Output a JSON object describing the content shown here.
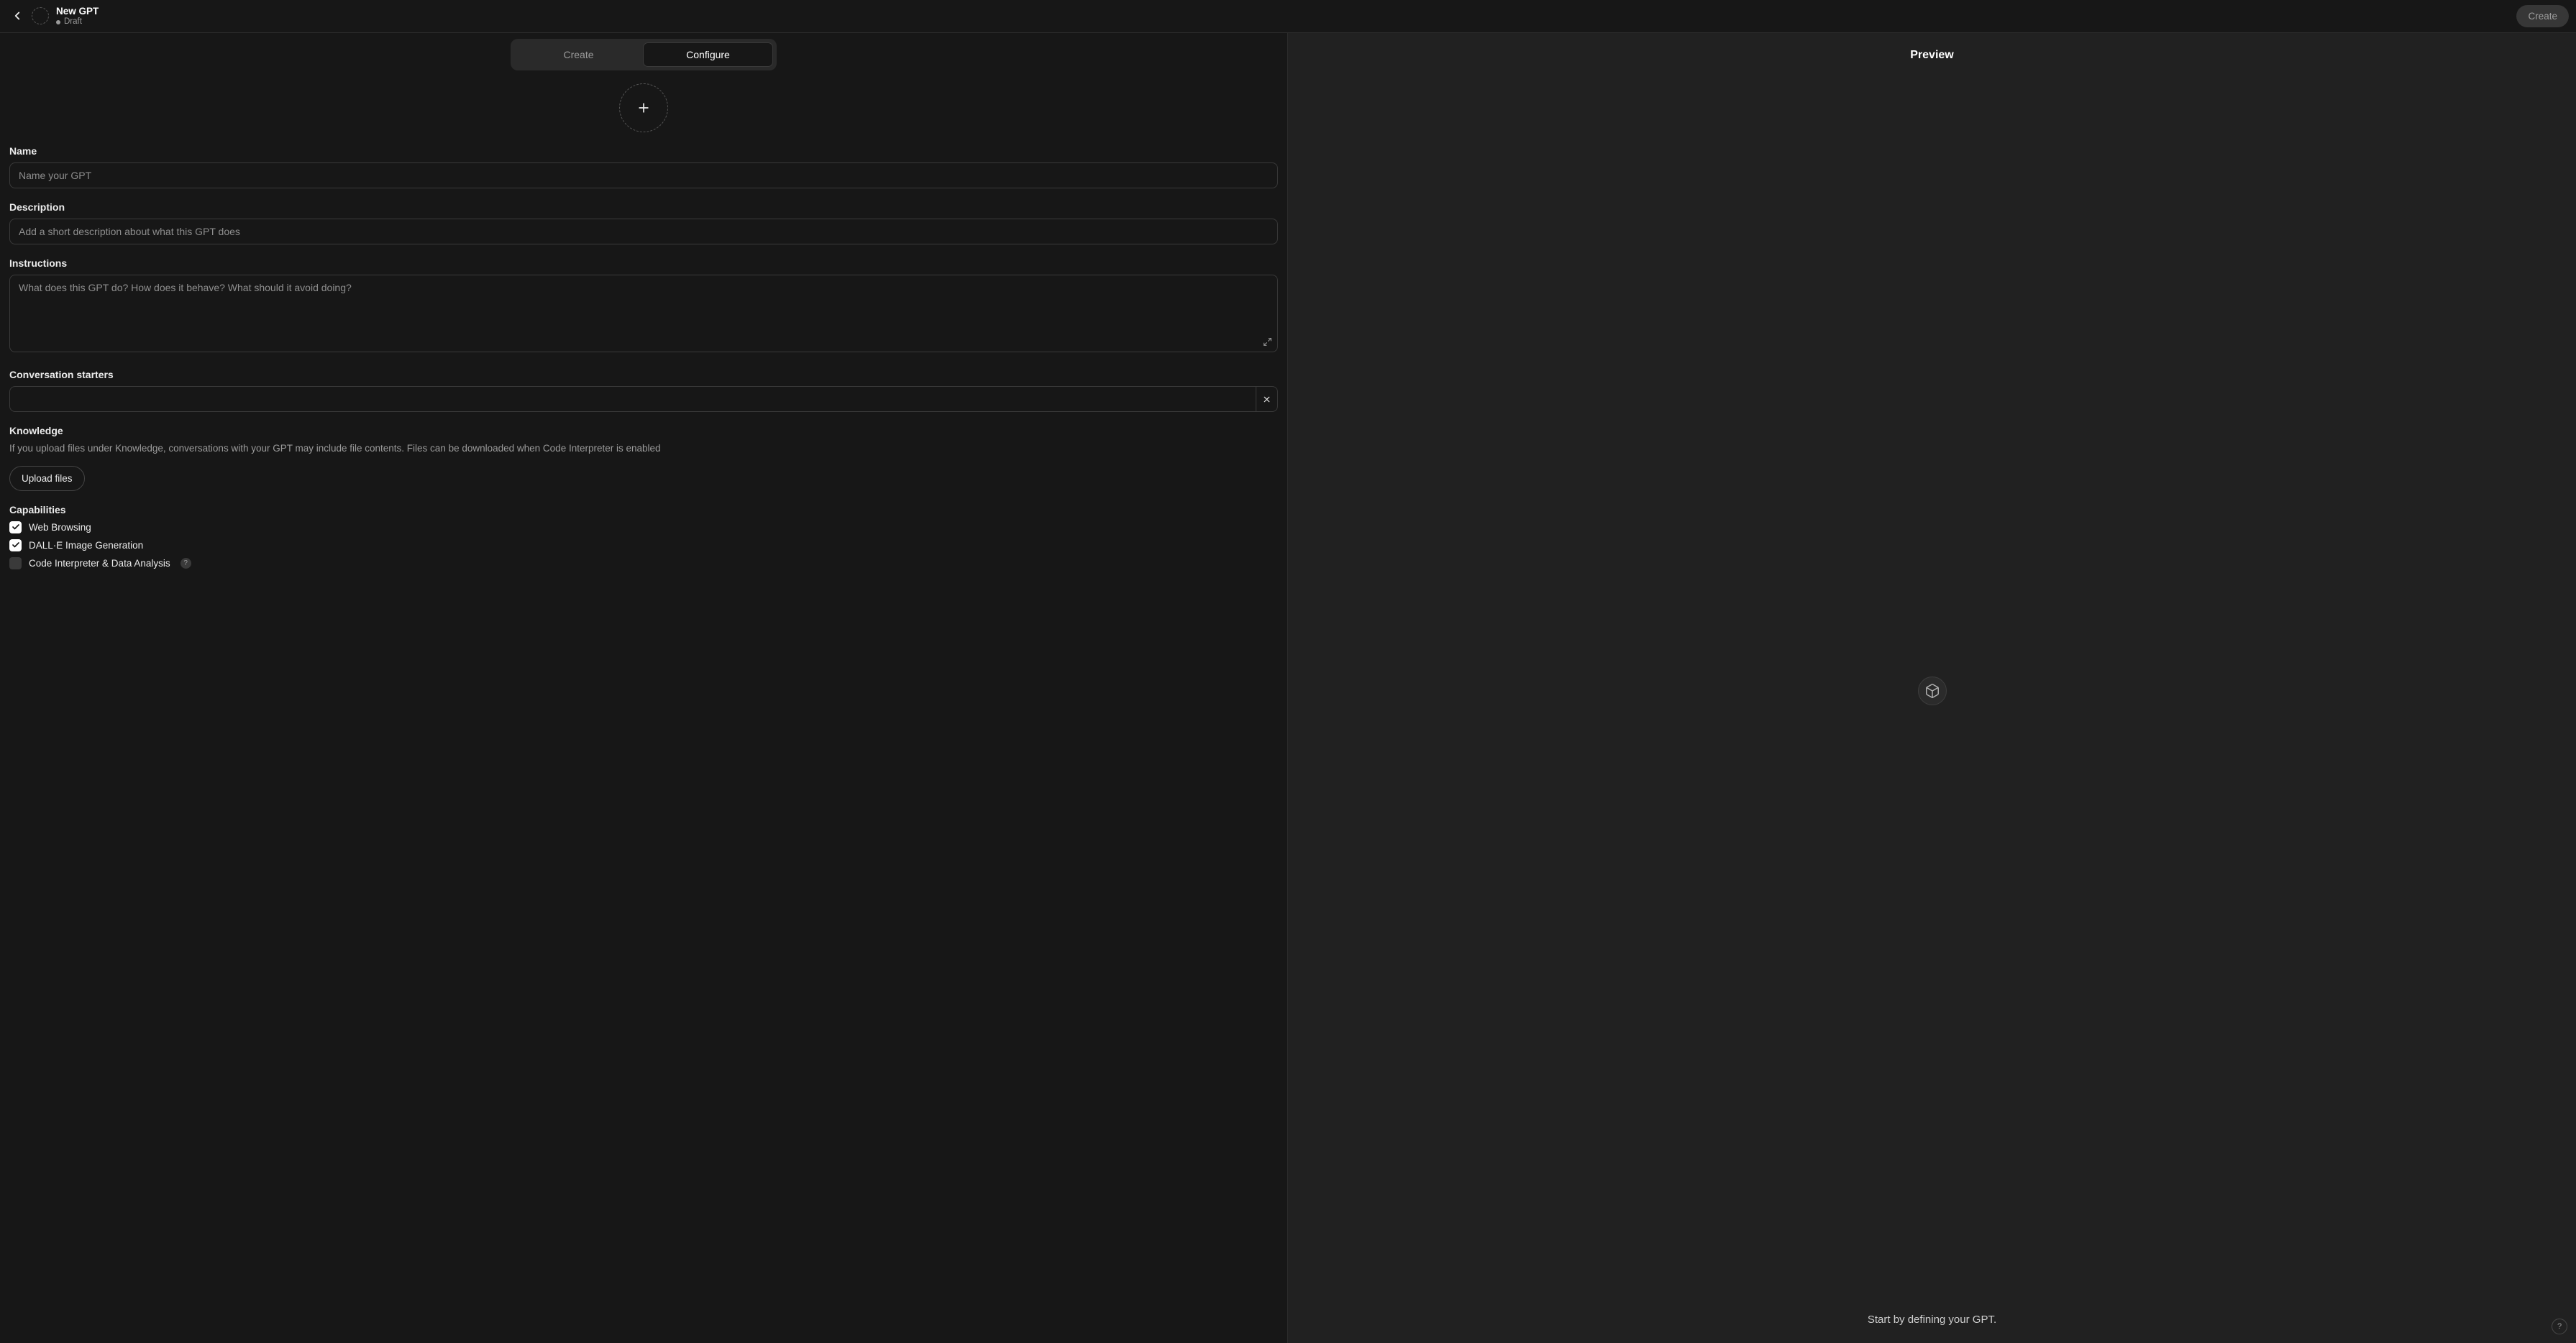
{
  "header": {
    "title": "New GPT",
    "status": "Draft",
    "create_button": "Create"
  },
  "tabs": {
    "create": "Create",
    "configure": "Configure"
  },
  "form": {
    "name": {
      "label": "Name",
      "placeholder": "Name your GPT"
    },
    "description": {
      "label": "Description",
      "placeholder": "Add a short description about what this GPT does"
    },
    "instructions": {
      "label": "Instructions",
      "placeholder": "What does this GPT do? How does it behave? What should it avoid doing?"
    },
    "starters": {
      "label": "Conversation starters"
    },
    "knowledge": {
      "label": "Knowledge",
      "help": "If you upload files under Knowledge, conversations with your GPT may include file contents. Files can be downloaded when Code Interpreter is enabled",
      "upload_button": "Upload files"
    },
    "capabilities": {
      "label": "Capabilities",
      "items": [
        {
          "label": "Web Browsing",
          "checked": true,
          "info": false
        },
        {
          "label": "DALL·E Image Generation",
          "checked": true,
          "info": false
        },
        {
          "label": "Code Interpreter & Data Analysis",
          "checked": false,
          "info": true
        }
      ]
    }
  },
  "preview": {
    "title": "Preview",
    "footer": "Start by defining your GPT."
  },
  "help_fab": "?"
}
